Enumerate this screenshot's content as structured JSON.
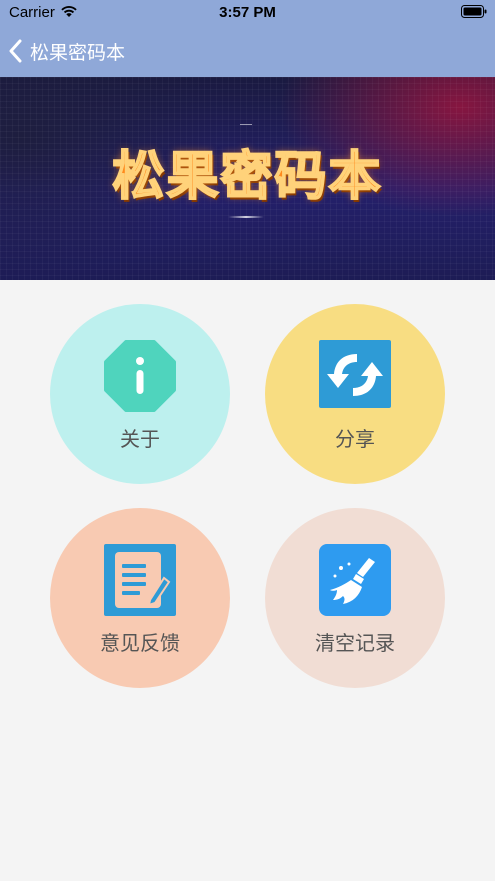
{
  "status_bar": {
    "carrier": "Carrier",
    "time": "3:57 PM"
  },
  "nav": {
    "title": "松果密码本"
  },
  "banner": {
    "title": "松果密码本"
  },
  "menu": {
    "about": {
      "label": "关于",
      "icon": "info-icon",
      "color": "#bdf0ee"
    },
    "share": {
      "label": "分享",
      "icon": "share-icon",
      "color": "#f8dd82"
    },
    "feedback": {
      "label": "意见反馈",
      "icon": "feedback-icon",
      "color": "#f8cab2"
    },
    "clear": {
      "label": "清空记录",
      "icon": "broom-icon",
      "color": "#f1ddd4"
    }
  }
}
